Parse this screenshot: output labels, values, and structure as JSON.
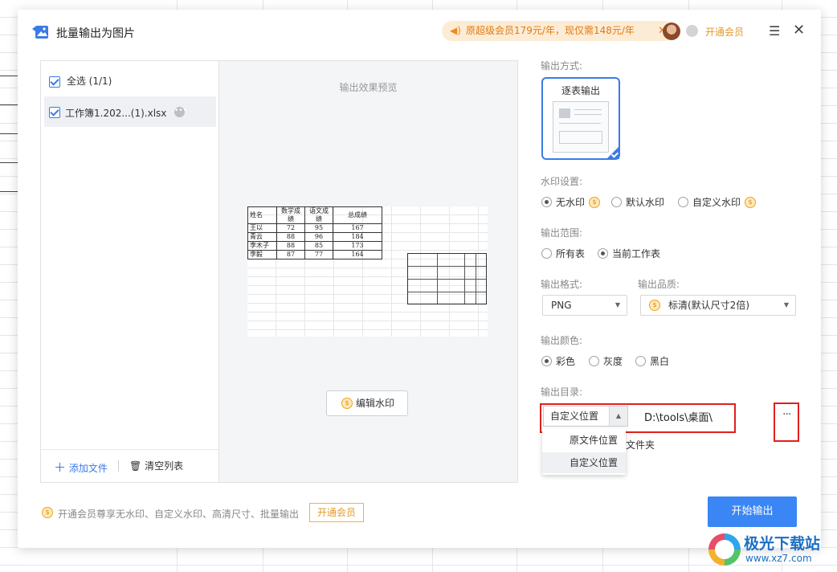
{
  "dialog": {
    "title": "批量输出为图片",
    "promo": "原超级会员179元/年，现仅需148元/年",
    "vip_link": "开通会员",
    "menu_glyph": "☰",
    "close_glyph": "✕"
  },
  "files": {
    "select_all": "全选 (1/1)",
    "items": [
      {
        "name": "工作簿1.202...(1).xlsx"
      }
    ],
    "add_file": "添加文件",
    "clear_list": "清空列表"
  },
  "preview": {
    "label": "输出效果预览",
    "sheet_headers": [
      "姓名",
      "数学成绩",
      "语文成绩",
      "总成绩"
    ],
    "sheet_rows": [
      [
        "王以",
        "72",
        "95",
        "167"
      ],
      [
        "青云",
        "88",
        "96",
        "184"
      ],
      [
        "李木子",
        "88",
        "85",
        "173"
      ],
      [
        "李毅",
        "87",
        "77",
        "164"
      ]
    ],
    "watermark_button": "编辑水印"
  },
  "settings": {
    "output_mode_label": "输出方式:",
    "output_mode_option": "逐表输出",
    "watermark_label": "水印设置:",
    "watermark_options": [
      "无水印",
      "默认水印",
      "自定义水印"
    ],
    "range_label": "输出范围:",
    "range_options": [
      "所有表",
      "当前工作表"
    ],
    "format_label": "输出格式:",
    "format_value": "PNG",
    "quality_label": "输出品质:",
    "quality_value": "标清(默认尺寸2倍)",
    "color_label": "输出颜色:",
    "color_options": [
      "彩色",
      "灰度",
      "黑白"
    ],
    "dir_label": "输出目录:",
    "dir_select_value": "自定义位置",
    "dir_path": "D:\\tools\\桌面\\",
    "dir_more": "···",
    "dir_options": [
      "原文件位置",
      "自定义位置"
    ],
    "folder_text": "文件夹"
  },
  "footer": {
    "note": "开通会员尊享无水印、自定义水印、高清尺寸、批量输出",
    "vip_button": "开通会员",
    "start_button": "开始输出"
  },
  "watermark_logo": {
    "title": "极光下载站",
    "url": "www.xz7.com"
  },
  "colors": {
    "accent": "#3a7be6",
    "start_button": "#3a86f5",
    "highlight_box": "#e0201c",
    "vip": "#e39a2a"
  }
}
